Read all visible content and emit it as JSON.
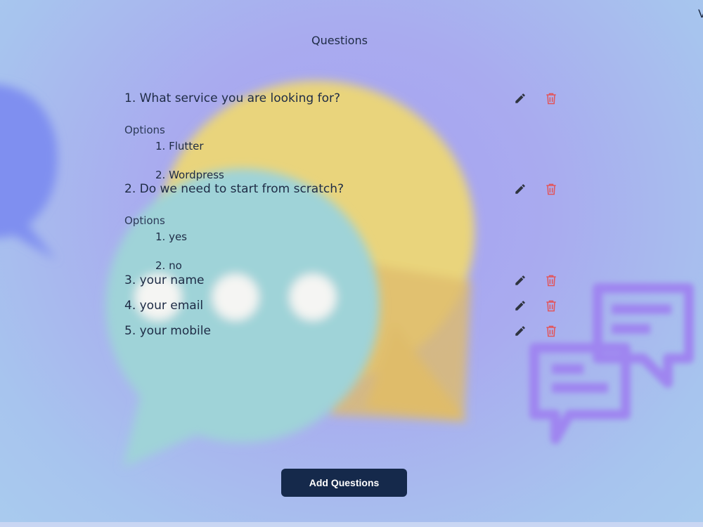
{
  "header": {
    "title": "Questions",
    "corner_text": "V"
  },
  "questions": [
    {
      "text": "1. What service you are looking for?",
      "options_label": "Options",
      "options": [
        "1. Flutter",
        "2. Wordpress"
      ]
    },
    {
      "text": "2. Do we need to start from scratch?",
      "options_label": "Options",
      "options": [
        "1. yes",
        "2. no"
      ]
    },
    {
      "text": "3. your name"
    },
    {
      "text": "4. your email"
    },
    {
      "text": "5. your mobile"
    }
  ],
  "footer": {
    "add_button_label": "Add Questions"
  },
  "colors": {
    "text": "#1e2b45",
    "edit_icon": "#2f3440",
    "delete_icon": "#e2545a",
    "button_bg": "#15294b"
  },
  "icons": {
    "edit": "pencil-icon",
    "delete": "trash-icon"
  }
}
